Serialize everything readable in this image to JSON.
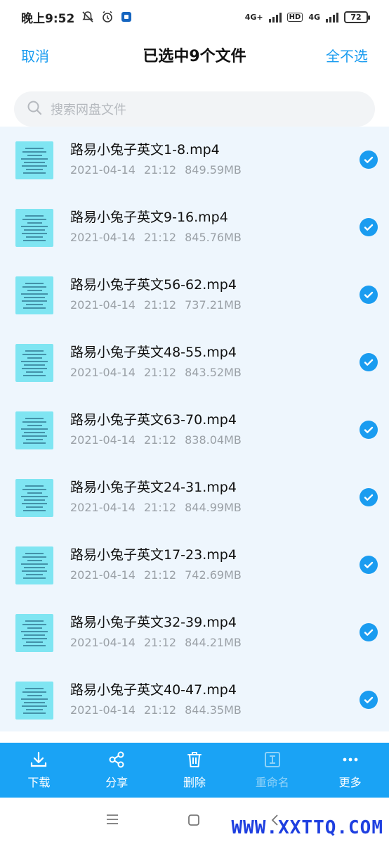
{
  "status": {
    "time": "晚上9:52",
    "battery": "72",
    "net1": "4G+",
    "net2": "4G",
    "hd": "HD"
  },
  "header": {
    "cancel_label": "取消",
    "title": "已选中9个文件",
    "deselect_label": "全不选"
  },
  "search": {
    "placeholder": "搜索网盘文件"
  },
  "files": [
    {
      "name": "路易小兔子英文1-8.mp4",
      "date": "2021-04-14",
      "time": "21:12",
      "size": "849.59MB"
    },
    {
      "name": "路易小兔子英文9-16.mp4",
      "date": "2021-04-14",
      "time": "21:12",
      "size": "845.76MB"
    },
    {
      "name": "路易小兔子英文56-62.mp4",
      "date": "2021-04-14",
      "time": "21:12",
      "size": "737.21MB"
    },
    {
      "name": "路易小兔子英文48-55.mp4",
      "date": "2021-04-14",
      "time": "21:12",
      "size": "843.52MB"
    },
    {
      "name": "路易小兔子英文63-70.mp4",
      "date": "2021-04-14",
      "time": "21:12",
      "size": "838.04MB"
    },
    {
      "name": "路易小兔子英文24-31.mp4",
      "date": "2021-04-14",
      "time": "21:12",
      "size": "844.99MB"
    },
    {
      "name": "路易小兔子英文17-23.mp4",
      "date": "2021-04-14",
      "time": "21:12",
      "size": "742.69MB"
    },
    {
      "name": "路易小兔子英文32-39.mp4",
      "date": "2021-04-14",
      "time": "21:12",
      "size": "844.21MB"
    },
    {
      "name": "路易小兔子英文40-47.mp4",
      "date": "2021-04-14",
      "time": "21:12",
      "size": "844.35MB"
    }
  ],
  "toolbar": {
    "download": "下载",
    "share": "分享",
    "delete": "删除",
    "rename": "重命名",
    "more": "更多"
  },
  "watermark": "WWW.XXTTQ.COM",
  "colors": {
    "accent": "#1a9cf0",
    "toolbar_bg": "#1aa3f5",
    "list_bg": "#eef6fd",
    "thumb_bg": "#7fe5f2"
  }
}
